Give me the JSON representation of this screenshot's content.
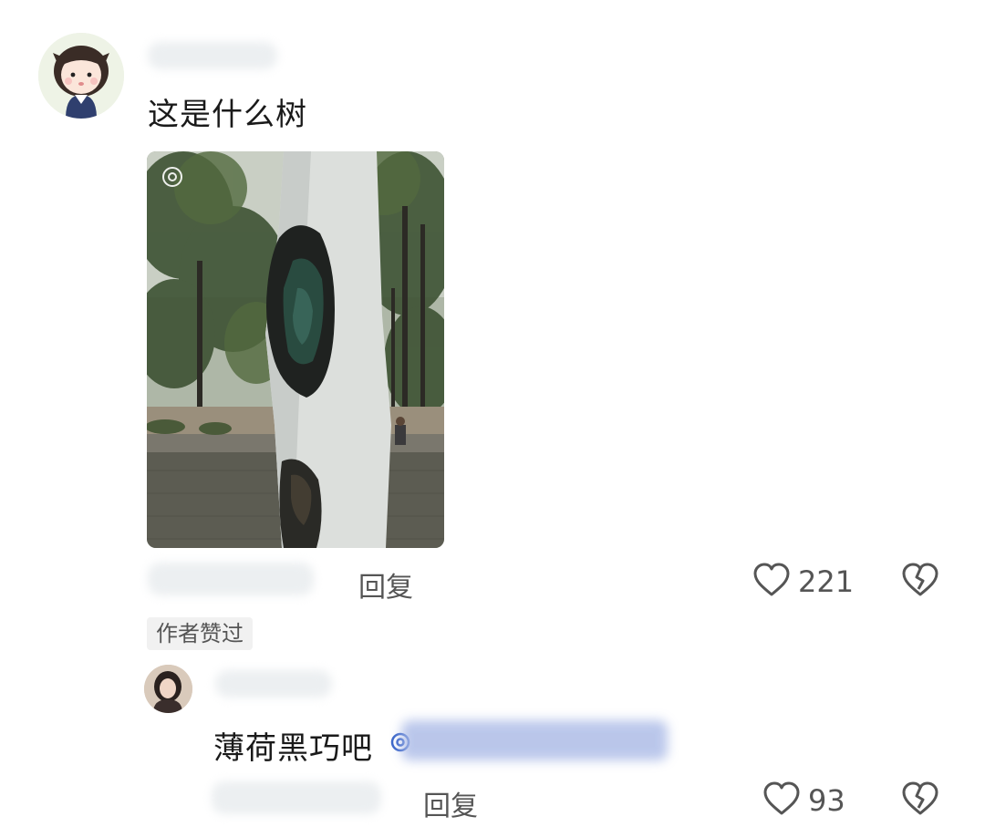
{
  "comment": {
    "text": "这是什么树",
    "reply_label": "回复",
    "like_count": "221"
  },
  "author_badge": "作者赞过",
  "reply": {
    "text": "薄荷黑巧吧",
    "reply_label": "回复",
    "like_count": "93"
  },
  "icons": {
    "like": "heart-outline-icon",
    "dislike": "broken-heart-icon",
    "mention": "at-icon"
  },
  "colors": {
    "text": "#1a1a1a",
    "secondary_text": "#555555",
    "badge_bg": "#f1f1f1",
    "mention_blur": "#a9b9e6"
  }
}
